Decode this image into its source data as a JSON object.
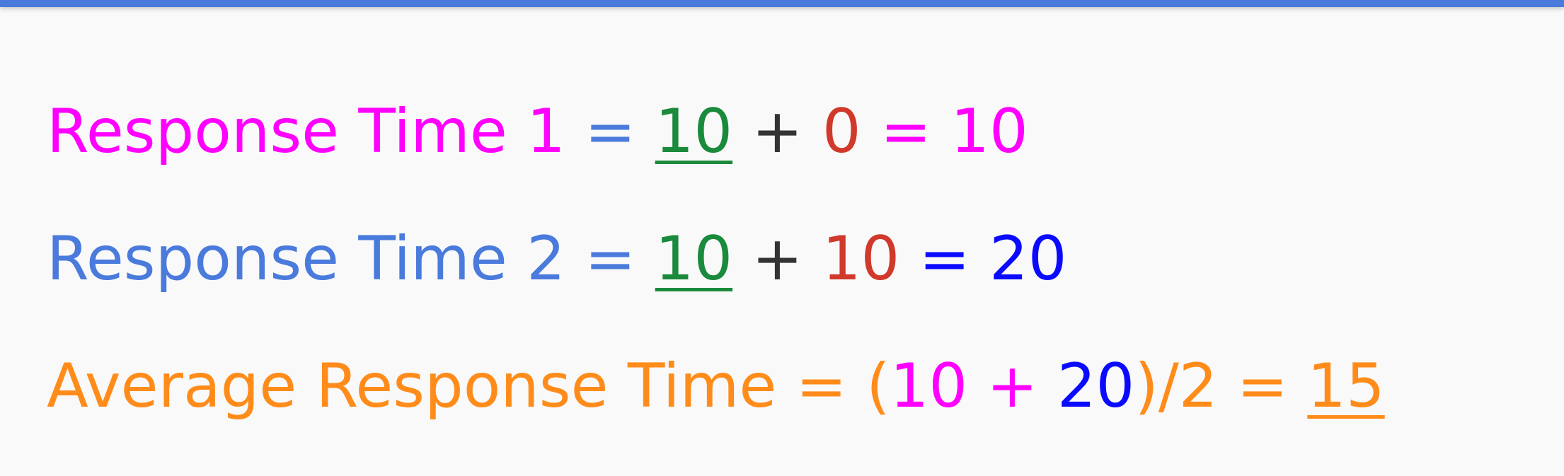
{
  "colors": {
    "magenta": "#ff00ff",
    "steel_blue": "#4a7bdc",
    "green": "#1a8a3c",
    "dark": "#333333",
    "red": "#d0392b",
    "blue": "#0a0aff",
    "orange": "#ff8c1a",
    "background": "#f9f9f9"
  },
  "line1": {
    "label": "Response Time 1",
    "eq": "=",
    "a": "10",
    "plus": "+",
    "b": "0",
    "eq2": "=",
    "result": "10"
  },
  "line2": {
    "label": "Response Time 2",
    "eq": "=",
    "a": "10",
    "plus": "+",
    "b": "10",
    "eq2": "=",
    "result": "20"
  },
  "line3": {
    "label": "Average Response Time",
    "eq": "=",
    "open": "(",
    "a": "10",
    "plus": "+",
    "b": "20",
    "close": ")/2",
    "eq2": "=",
    "result": "15"
  }
}
